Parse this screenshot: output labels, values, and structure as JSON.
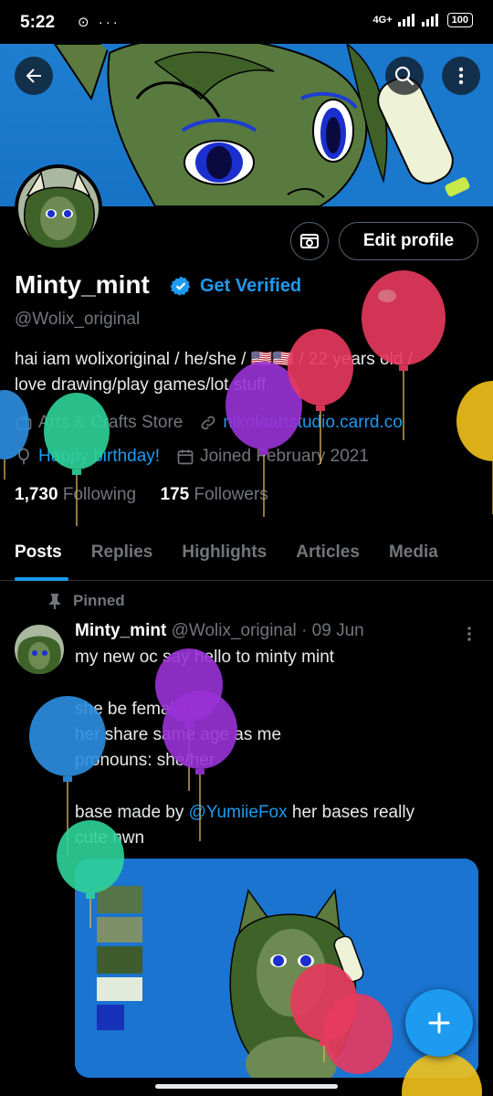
{
  "status_bar": {
    "time": "5:22",
    "left_icons": "⊙ ···",
    "network": "4G+",
    "battery": "100"
  },
  "profile": {
    "display_name": "Minty_mint",
    "get_verified": "Get Verified",
    "handle": "@Wolix_original",
    "bio_line1": "hai iam wolixoriginal / he/she / 🇺🇸🇺🇸 / 22 years old /",
    "bio_line2": "love drawing/play games/lot stuff",
    "category": "Arts & Crafts Store",
    "website": "nikolaartstudio.carrd.co",
    "birthday": "Happy birthday!",
    "joined": "Joined February 2021",
    "following_count": "1,730",
    "following_label": "Following",
    "followers_count": "175",
    "followers_label": "Followers",
    "edit_profile": "Edit profile"
  },
  "tabs": [
    {
      "label": "Posts",
      "active": true
    },
    {
      "label": "Replies",
      "active": false
    },
    {
      "label": "Highlights",
      "active": false
    },
    {
      "label": "Articles",
      "active": false
    },
    {
      "label": "Media",
      "active": false
    }
  ],
  "post": {
    "pinned_label": "Pinned",
    "author_name": "Minty_mint",
    "author_handle": "@Wolix_original",
    "date": "· 09 Jun",
    "line1": "my new oc say hello to minty mint",
    "line2": "she be female fox",
    "line3": "her share same age as me",
    "line4": "pronouns: she/her",
    "line5_prefix": "base made by ",
    "line5_mention": "@YumiieFox",
    "line5_suffix": " her bases really",
    "line6": "cute nwn"
  },
  "icons": {
    "back": "arrow-left-icon",
    "search": "search-icon",
    "more": "more-vertical-icon",
    "verified": "verified-badge-icon",
    "category": "briefcase-icon",
    "link": "link-icon",
    "birthday": "balloon-icon",
    "calendar": "calendar-icon",
    "pin": "pin-icon",
    "compose": "plus-icon"
  },
  "colors": {
    "accent": "#1d9bf0",
    "muted": "#71767b",
    "background": "#000000",
    "balloon_red": "#e83a5f",
    "balloon_purple": "#9a32d6",
    "balloon_green": "#2fd39a",
    "balloon_blue": "#2d8fe0",
    "balloon_yellow": "#f2c21b"
  }
}
